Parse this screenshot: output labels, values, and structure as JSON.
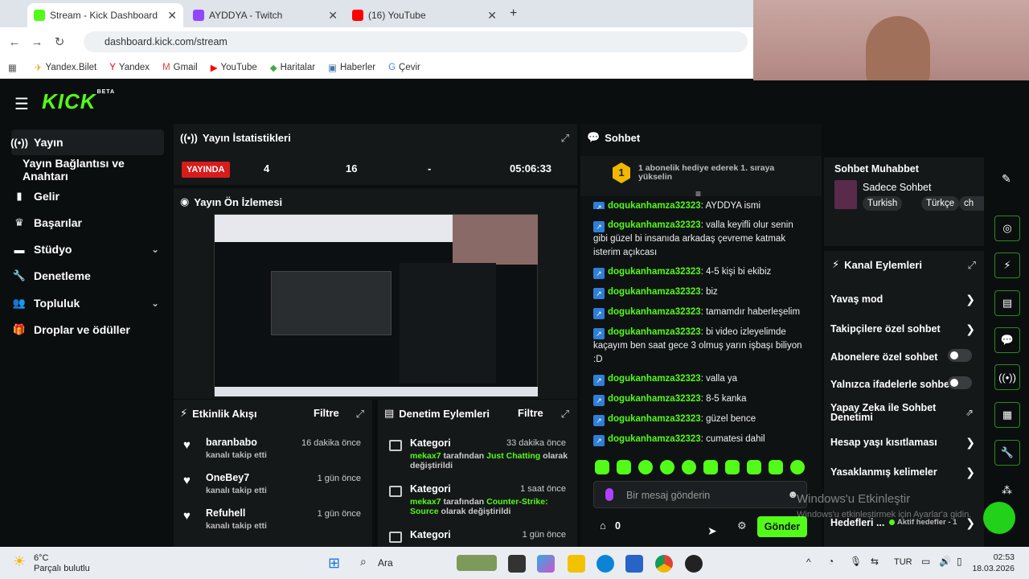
{
  "browser": {
    "tabs": [
      {
        "title": "Stream - Kick Dashboard",
        "active": true
      },
      {
        "title": "AYDDYA - Twitch",
        "active": false
      },
      {
        "title": "(16) YouTube",
        "active": false
      }
    ],
    "url": "dashboard.kick.com/stream",
    "bookmarks": [
      "Yandex.Bilet",
      "Yandex",
      "Gmail",
      "YouTube",
      "Haritalar",
      "Haberler",
      "Çevir"
    ]
  },
  "brand": {
    "logo": "KICK",
    "tag": "BETA",
    "accent": "#53fc18"
  },
  "sidebar": {
    "items": [
      {
        "label": "Yayın",
        "icon": "broadcast-icon"
      },
      {
        "label": "Yayın Bağlantısı ve Anahtarı",
        "icon": ""
      },
      {
        "label": "Gelir",
        "icon": "bar-chart-icon"
      },
      {
        "label": "Başarılar",
        "icon": "trophy-icon"
      },
      {
        "label": "Stüdyo",
        "icon": "studio-icon"
      },
      {
        "label": "Denetleme",
        "icon": "wrench-icon"
      },
      {
        "label": "Topluluk",
        "icon": "people-icon"
      },
      {
        "label": "Droplar ve ödüller",
        "icon": "gift-icon"
      }
    ]
  },
  "stats": {
    "title": "Yayın İstatistikleri",
    "live_label": "YAYINDA",
    "values": [
      "4",
      "16",
      "-",
      "05:06:33"
    ]
  },
  "preview": {
    "title": "Yayın Ön İzlemesi"
  },
  "activity": {
    "title": "Etkinlik Akışı",
    "filter": "Filtre",
    "items": [
      {
        "name": "baranbabo",
        "desc": "kanalı takip etti",
        "time": "16 dakika önce"
      },
      {
        "name": "OneBey7",
        "desc": "kanalı takip etti",
        "time": "1 gün önce"
      },
      {
        "name": "Refuhell",
        "desc": "kanalı takip etti",
        "time": "1 gün önce"
      }
    ]
  },
  "moderation": {
    "title": "Denetim Eylemleri",
    "filter": "Filtre",
    "items": [
      {
        "name": "Kategori",
        "time": "33 dakika önce",
        "user": "mekax7",
        "mid": " tarafından ",
        "target": "Just Chatting",
        "end": " olarak değiştirildi"
      },
      {
        "name": "Kategori",
        "time": "1 saat önce",
        "user": "mekax7",
        "mid": " tarafından ",
        "target": "Counter-Strike: Source",
        "end": " olarak değiştirildi"
      },
      {
        "name": "Kategori",
        "time": "1 gün önce",
        "user": "",
        "mid": "",
        "target": "",
        "end": ""
      }
    ]
  },
  "chat": {
    "title": "Sohbet",
    "gift_rank": "1",
    "gift_text": "1 abonelik hediye ederek 1. sıraya yükselin",
    "messages": [
      {
        "user": "dogukanhamza32323",
        "text": "AYDDYA ismi"
      },
      {
        "user": "dogukanhamza32323",
        "text": "valla keyifli olur senin gibi güzel bi insanıda arkadaş çevreme katmak isterim açıkcası"
      },
      {
        "user": "dogukanhamza32323",
        "text": "4-5 kişi bi ekibiz"
      },
      {
        "user": "dogukanhamza32323",
        "text": "biz"
      },
      {
        "user": "dogukanhamza32323",
        "text": "tamamdır haberleşelim"
      },
      {
        "user": "dogukanhamza32323",
        "text": "bi video izleyelimde kaçayım ben saat gece 3 olmuş yarın işbaşı biliyon :D"
      },
      {
        "user": "dogukanhamza32323",
        "text": "valla ya"
      },
      {
        "user": "dogukanhamza32323",
        "text": "8-5 kanka"
      },
      {
        "user": "dogukanhamza32323",
        "text": "güzel bence"
      },
      {
        "user": "dogukanhamza32323",
        "text": "cumatesi dahil"
      }
    ],
    "placeholder": "Bir mesaj gönderin",
    "points": "0",
    "send_label": "Gönder"
  },
  "chat_mode": {
    "title": "Sohbet Muhabbet",
    "name": "Sadece Sohbet",
    "tags": [
      "Turkish",
      "Türkçe",
      "ch"
    ]
  },
  "channel_actions": {
    "title": "Kanal Eylemleri",
    "items": [
      {
        "label": "Yavaş mod",
        "control": "arrow"
      },
      {
        "label": "Takipçilere özel sohbet",
        "control": "arrow"
      },
      {
        "label": "Abonelere özel sohbet",
        "control": "toggle"
      },
      {
        "label": "Yalnızca ifadelerle sohbet",
        "control": "toggle"
      },
      {
        "label": "Yapay Zeka ile Sohbet Denetimi",
        "control": "external"
      },
      {
        "label": "Hesap yaşı kısıtlaması",
        "control": "arrow"
      },
      {
        "label": "Yasaklanmış kelimeler",
        "control": "arrow"
      }
    ],
    "footer_label": "Hedefleri ...",
    "footer_status": "Aktif hedefler - 1"
  },
  "watermark": {
    "line1": "Windows'u Etkinleştir",
    "line2": "Windows'u etkinleştirmek için Ayarlar'a gidin."
  },
  "taskbar": {
    "weather_temp": "6°C",
    "weather_desc": "Parçalı bulutlu",
    "search": "Ara",
    "lang": "TUR",
    "time": "02:53",
    "date": "18.03.2026"
  }
}
